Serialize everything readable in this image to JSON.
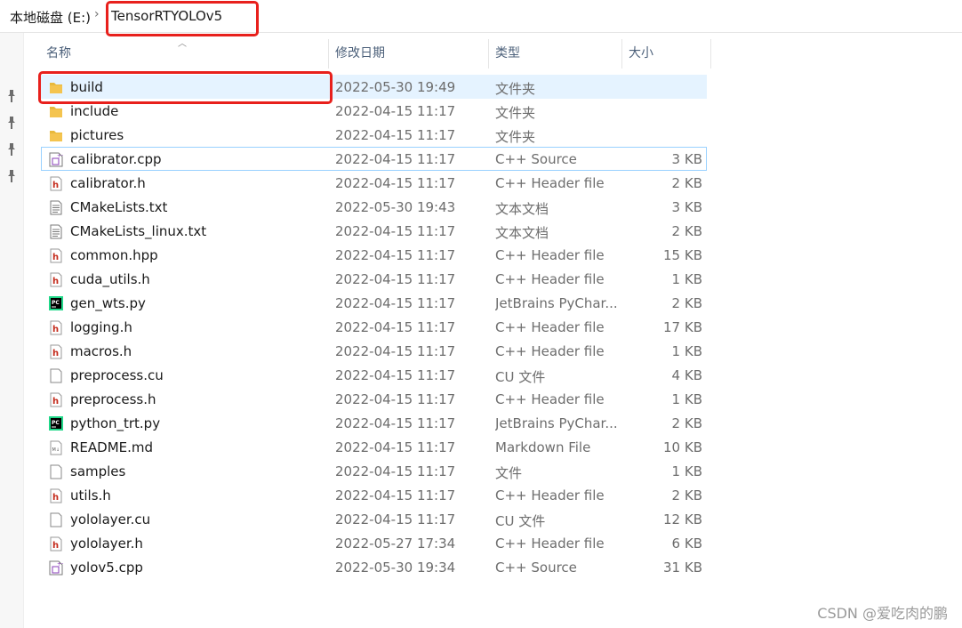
{
  "breadcrumb": {
    "drive": "本地磁盘 (E:)",
    "folder": "TensorRTYOLOv5"
  },
  "columns": {
    "name": "名称",
    "date": "修改日期",
    "type": "类型",
    "size": "大小"
  },
  "files": [
    {
      "name": "build",
      "date": "2022-05-30 19:49",
      "type": "文件夹",
      "size": "",
      "icon": "folder-icon"
    },
    {
      "name": "include",
      "date": "2022-04-15 11:17",
      "type": "文件夹",
      "size": "",
      "icon": "folder-icon"
    },
    {
      "name": "pictures",
      "date": "2022-04-15 11:17",
      "type": "文件夹",
      "size": "",
      "icon": "folder-icon"
    },
    {
      "name": "calibrator.cpp",
      "date": "2022-04-15 11:17",
      "type": "C++ Source",
      "size": "3 KB",
      "icon": "cpp-source-icon"
    },
    {
      "name": "calibrator.h",
      "date": "2022-04-15 11:17",
      "type": "C++ Header file",
      "size": "2 KB",
      "icon": "header-file-icon"
    },
    {
      "name": "CMakeLists.txt",
      "date": "2022-05-30 19:43",
      "type": "文本文档",
      "size": "3 KB",
      "icon": "text-file-icon"
    },
    {
      "name": "CMakeLists_linux.txt",
      "date": "2022-04-15 11:17",
      "type": "文本文档",
      "size": "2 KB",
      "icon": "text-file-icon"
    },
    {
      "name": "common.hpp",
      "date": "2022-04-15 11:17",
      "type": "C++ Header file",
      "size": "15 KB",
      "icon": "header-file-icon"
    },
    {
      "name": "cuda_utils.h",
      "date": "2022-04-15 11:17",
      "type": "C++ Header file",
      "size": "1 KB",
      "icon": "header-file-icon"
    },
    {
      "name": "gen_wts.py",
      "date": "2022-04-15 11:17",
      "type": "JetBrains PyChar...",
      "size": "2 KB",
      "icon": "pycharm-icon"
    },
    {
      "name": "logging.h",
      "date": "2022-04-15 11:17",
      "type": "C++ Header file",
      "size": "17 KB",
      "icon": "header-file-icon"
    },
    {
      "name": "macros.h",
      "date": "2022-04-15 11:17",
      "type": "C++ Header file",
      "size": "1 KB",
      "icon": "header-file-icon"
    },
    {
      "name": "preprocess.cu",
      "date": "2022-04-15 11:17",
      "type": "CU 文件",
      "size": "4 KB",
      "icon": "blank-file-icon"
    },
    {
      "name": "preprocess.h",
      "date": "2022-04-15 11:17",
      "type": "C++ Header file",
      "size": "1 KB",
      "icon": "header-file-icon"
    },
    {
      "name": "python_trt.py",
      "date": "2022-04-15 11:17",
      "type": "JetBrains PyChar...",
      "size": "2 KB",
      "icon": "pycharm-icon"
    },
    {
      "name": "README.md",
      "date": "2022-04-15 11:17",
      "type": "Markdown File",
      "size": "10 KB",
      "icon": "markdown-file-icon"
    },
    {
      "name": "samples",
      "date": "2022-04-15 11:17",
      "type": "文件",
      "size": "1 KB",
      "icon": "blank-file-icon"
    },
    {
      "name": "utils.h",
      "date": "2022-04-15 11:17",
      "type": "C++ Header file",
      "size": "2 KB",
      "icon": "header-file-icon"
    },
    {
      "name": "yololayer.cu",
      "date": "2022-04-15 11:17",
      "type": "CU 文件",
      "size": "12 KB",
      "icon": "blank-file-icon"
    },
    {
      "name": "yololayer.h",
      "date": "2022-05-27 17:34",
      "type": "C++ Header file",
      "size": "6 KB",
      "icon": "header-file-icon"
    },
    {
      "name": "yolov5.cpp",
      "date": "2022-05-30 19:34",
      "type": "C++ Source",
      "size": "31 KB",
      "icon": "cpp-source-icon"
    }
  ],
  "watermark": "CSDN @爱吃肉的鹏",
  "colors": {
    "highlight": "#e8201c",
    "selection": "#e5f3ff",
    "folder": "#f4c44f",
    "header_h": "#c42b1c"
  }
}
